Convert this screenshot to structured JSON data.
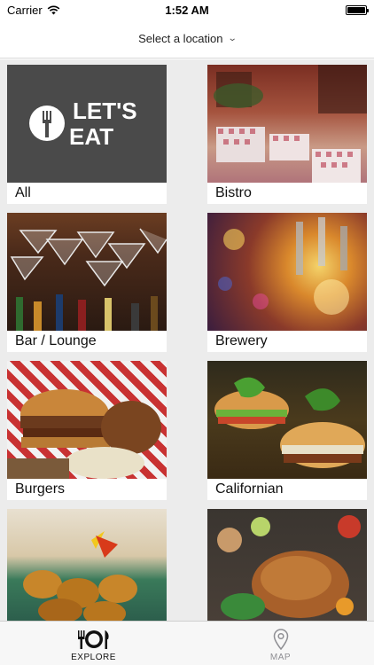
{
  "status_bar": {
    "carrier": "Carrier",
    "time": "1:52 AM",
    "battery_level": 1.0
  },
  "location_picker": {
    "label": "Select a location",
    "icon": "chevron-down-icon"
  },
  "categories": [
    {
      "label": "All",
      "logo_text": "LET'S EAT"
    },
    {
      "label": "Bistro"
    },
    {
      "label": "Bar / Lounge"
    },
    {
      "label": "Brewery"
    },
    {
      "label": "Burgers"
    },
    {
      "label": "Californian"
    },
    {
      "label": ""
    },
    {
      "label": ""
    }
  ],
  "tabs": [
    {
      "label": "EXPLORE",
      "icon": "plate-cutlery-icon",
      "active": true
    },
    {
      "label": "MAP",
      "icon": "map-pin-icon",
      "active": false
    }
  ],
  "colors": {
    "logo_bg": "#4a4a4a",
    "tab_active": "#111111",
    "tab_inactive": "#8e8e93"
  }
}
